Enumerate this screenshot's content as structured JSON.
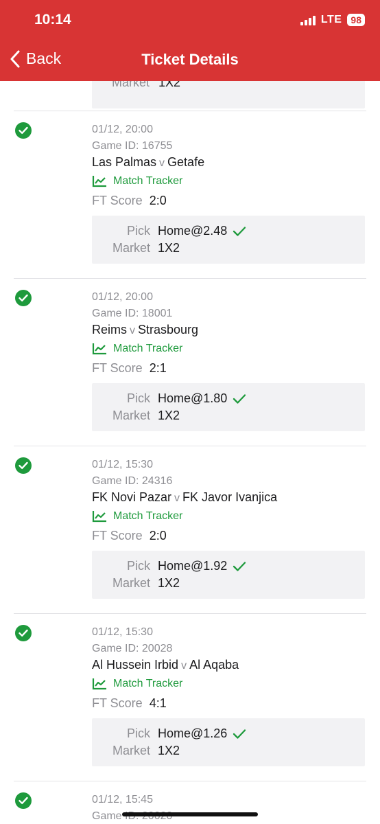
{
  "status_bar": {
    "time": "10:14",
    "network": "LTE",
    "battery": "98"
  },
  "nav": {
    "back_label": "Back",
    "title": "Ticket Details"
  },
  "previous_item": {
    "market_label": "Market",
    "market_value": "1X2"
  },
  "labels": {
    "score": "FT Score",
    "tracker": "Match Tracker",
    "pick": "Pick",
    "market": "Market",
    "versus": "v"
  },
  "bets": [
    {
      "datetime": "01/12, 20:00",
      "game_id": "Game ID: 16755",
      "home": "Las Palmas",
      "away": "Getafe",
      "score": "2:0",
      "pick": "Home@2.48",
      "market": "1X2",
      "won": true
    },
    {
      "datetime": "01/12, 20:00",
      "game_id": "Game ID: 18001",
      "home": "Reims",
      "away": "Strasbourg",
      "score": "2:1",
      "pick": "Home@1.80",
      "market": "1X2",
      "won": true
    },
    {
      "datetime": "01/12, 15:30",
      "game_id": "Game ID: 24316",
      "home": "FK Novi Pazar",
      "away": "FK Javor Ivanjica",
      "score": "2:0",
      "pick": "Home@1.92",
      "market": "1X2",
      "won": true
    },
    {
      "datetime": "01/12, 15:30",
      "game_id": "Game ID: 20028",
      "home": "Al Hussein Irbid",
      "away": "Al Aqaba",
      "score": "4:1",
      "pick": "Home@1.26",
      "market": "1X2",
      "won": true
    },
    {
      "datetime": "01/12, 15:45",
      "game_id": "Game ID: 20020",
      "won": true
    }
  ],
  "colors": {
    "header": "#d83434",
    "success": "#1e9a3c",
    "muted": "#8e8e93",
    "card": "#f2f2f4"
  },
  "icons": [
    "chevron-left-icon",
    "check-circle-icon",
    "chart-line-icon",
    "checkmark-icon"
  ]
}
